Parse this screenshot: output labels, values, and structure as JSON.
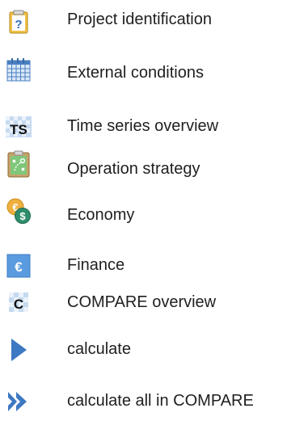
{
  "legend": {
    "items": [
      {
        "icon": "project-identification-icon",
        "label": "Project identification"
      },
      {
        "icon": "calendar-icon",
        "label": "External conditions"
      },
      {
        "icon": "time-series-icon",
        "label": "Time series overview"
      },
      {
        "icon": "operation-strategy-icon",
        "label": "Operation strategy"
      },
      {
        "icon": "economy-coins-icon",
        "label": "Economy"
      },
      {
        "icon": "euro-icon",
        "label": "Finance"
      },
      {
        "icon": "compare-icon",
        "label": "COMPARE overview"
      },
      {
        "icon": "play-icon",
        "label": "calculate"
      },
      {
        "icon": "double-chevron-icon",
        "label": "calculate all in COMPARE"
      }
    ],
    "icon_glyphs": {
      "project_identification": "?",
      "time_series": "TS",
      "euro": "€",
      "dollar": "$",
      "compare": "C"
    }
  }
}
